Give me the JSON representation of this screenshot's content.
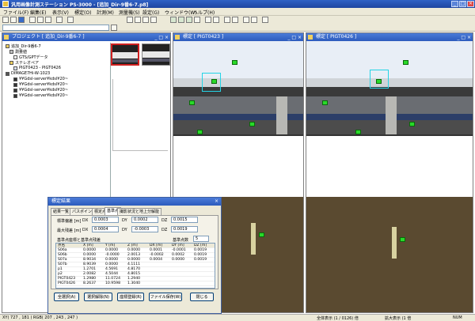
{
  "app": {
    "title": "汎用画像計測ステーション PS-3000 - [追加_Dir-9番6-7.p8]",
    "window_buttons": [
      "_",
      "□",
      "×"
    ]
  },
  "menu": [
    "ファイル(F)",
    "編集(E)",
    "表示(V)",
    "標定(O)",
    "計測(M)",
    "測量機(S)",
    "設定(G)",
    "ウィンドウ(W)",
    "ヘルプ(H)"
  ],
  "toolbar": {
    "combo_value": ""
  },
  "project": {
    "title": "プロジェクト [ 追加_Dir-9番6-7 ]",
    "items": [
      {
        "label": "追加_Dir-9番6-7",
        "indent": 0
      },
      {
        "label": "測量値",
        "indent": 1
      },
      {
        "label": "GTS/GPTデータ",
        "indent": 2
      },
      {
        "label": "ステレオペア",
        "indent": 1
      },
      {
        "label": "PIGT0423 - PIGT0426",
        "indent": 2
      },
      {
        "label": "DIMAGE7Hi-W-1023",
        "indent": 0
      },
      {
        "label": "¥¥Gdsl-server¥kdsl¥20~",
        "indent": 2
      },
      {
        "label": "¥¥Gdsl-server¥kdsl¥20~",
        "indent": 2
      },
      {
        "label": "¥¥Gdsl-server¥kdsl¥20~",
        "indent": 2
      },
      {
        "label": "¥¥Gdsl-server¥kdsl¥20~",
        "indent": 2
      }
    ]
  },
  "view_left": {
    "title": "標定 [ PIGT0423 ]"
  },
  "view_right": {
    "title": "標定 [ PIGT0426 ]"
  },
  "dialog": {
    "title": "標定結果",
    "tabs": [
      "結果一覧",
      "パスポイント",
      "標定点",
      "基準点",
      "撮影状況と地上分解能"
    ],
    "std_dev_label": "標準偏差 [m]",
    "max_dev_label": "最大残差 [m]",
    "dx_label": "DX",
    "dy_label": "DY",
    "dz_label": "DZ",
    "std_dx": "0.0003",
    "std_dy": "0.0002",
    "std_dz": "0.0015",
    "max_dx": "0.0004",
    "max_dy": "-0.0003",
    "max_dz": "0.0019",
    "table_caption": "基準点座標と基準点残差",
    "point_count_label": "基準点数",
    "point_count": "5",
    "columns": [
      "点名",
      "X [m]",
      "Y [m]",
      "Z [m]",
      "DX [m]",
      "DY [m]",
      "DZ [m]"
    ],
    "rows": [
      [
        "S06a",
        "0.0000",
        "0.0000",
        "0.0000",
        "0.0001",
        "-0.0001",
        "0.0019"
      ],
      [
        "S06b",
        "0.0000",
        "-0.0000",
        "2.0013",
        "-0.0002",
        "0.0002",
        "0.0019"
      ],
      [
        "S07a",
        "8.9034",
        "0.0000",
        "0.0000",
        "0.0004",
        "0.0000",
        "0.0019"
      ],
      [
        "S07b",
        "8.9039",
        "0.0000",
        "4.1111",
        "",
        "",
        ""
      ],
      [
        "p1",
        "1.2701",
        "4.5691",
        "4.8170",
        "",
        "",
        ""
      ],
      [
        "p2",
        "2.0082",
        "4.5044",
        "4.8015",
        "",
        "",
        ""
      ],
      [
        "PIGT0423",
        "1.2980",
        "11.0724",
        "1.2940",
        "",
        "",
        ""
      ],
      [
        "PIGT0426",
        "8.2637",
        "10.9598",
        "1.3040",
        "",
        "",
        ""
      ]
    ],
    "buttons": [
      "全選択(A)",
      "選択解除(N)",
      "座標登録(R)",
      "ファイル保存(W)",
      "閉じる"
    ]
  },
  "status": {
    "coords": "XY( 727 , 181 ) RGB( 207 , 243 , 247 )",
    "display": "全体表示 (1 / 0126) 倍",
    "zoom": "拡大表示 (1 倍",
    "num": "NUM"
  }
}
